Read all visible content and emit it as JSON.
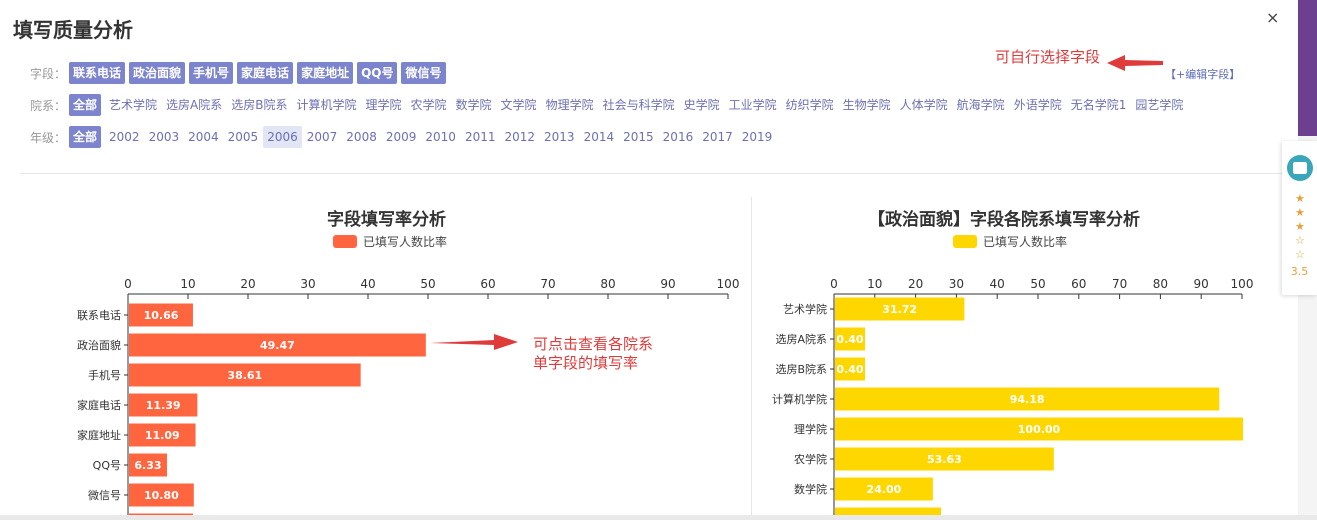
{
  "title": "填写质量分析",
  "close_label": "×",
  "filters": {
    "field_label": "字段：",
    "fields": [
      "联系电话",
      "政治面貌",
      "手机号",
      "家庭电话",
      "家庭地址",
      "QQ号",
      "微信号"
    ],
    "edit_link": "【+编辑字段】",
    "college_label": "院系：",
    "college_all": "全部",
    "colleges": [
      "艺术学院",
      "选房A院系",
      "选房B院系",
      "计算机学院",
      "理学院",
      "农学院",
      "数学院",
      "文学院",
      "物理学院",
      "社会与科学院",
      "史学院",
      "工业学院",
      "纺织学院",
      "生物学院",
      "人体学院",
      "航海学院",
      "外语学院",
      "无名学院1",
      "园艺学院"
    ],
    "year_label": "年级：",
    "year_all": "全部",
    "years": [
      "2002",
      "2003",
      "2004",
      "2005",
      "2006",
      "2007",
      "2008",
      "2009",
      "2010",
      "2011",
      "2012",
      "2013",
      "2014",
      "2015",
      "2016",
      "2017",
      "2019"
    ],
    "selected_year": "2006"
  },
  "annotations": {
    "edit_hint": "可自行选择字段",
    "click_hint_line1": "可点击查看各院系",
    "click_hint_line2": "单字段的填写率"
  },
  "colors": {
    "accent": "#7b84cc",
    "bar_orange": "#ff6640",
    "bar_yellow": "#ffd700",
    "annotation_red": "#e03b3b"
  },
  "chart_data": [
    {
      "type": "bar",
      "orientation": "horizontal",
      "title": "字段填写率分析",
      "legend": "已填写人数比率",
      "categories": [
        "联系电话",
        "政治面貌",
        "手机号",
        "家庭电话",
        "家庭地址",
        "QQ号",
        "微信号"
      ],
      "values": [
        10.66,
        49.47,
        38.61,
        11.39,
        11.09,
        6.33,
        10.8
      ],
      "xlim": [
        0,
        100
      ],
      "ticks": [
        0,
        10,
        20,
        30,
        40,
        50,
        60,
        70,
        80,
        90,
        100
      ],
      "color": "#ff6640"
    },
    {
      "type": "bar",
      "orientation": "horizontal",
      "title": "【政治面貌】字段各院系填写率分析",
      "legend": "已填写人数比率",
      "categories": [
        "艺术学院",
        "选房A院系",
        "选房B院系",
        "计算机学院",
        "理学院",
        "农学院",
        "数学院"
      ],
      "values": [
        31.72,
        0.4,
        0.4,
        94.18,
        100.0,
        53.63,
        24.0
      ],
      "xlim": [
        0,
        100
      ],
      "ticks": [
        0,
        10,
        20,
        30,
        40,
        50,
        60,
        70,
        80,
        90,
        100
      ],
      "color": "#ffd700"
    }
  ],
  "widget": {
    "stars": [
      "★",
      "★",
      "★",
      "☆",
      "☆"
    ],
    "score": "3.5"
  }
}
